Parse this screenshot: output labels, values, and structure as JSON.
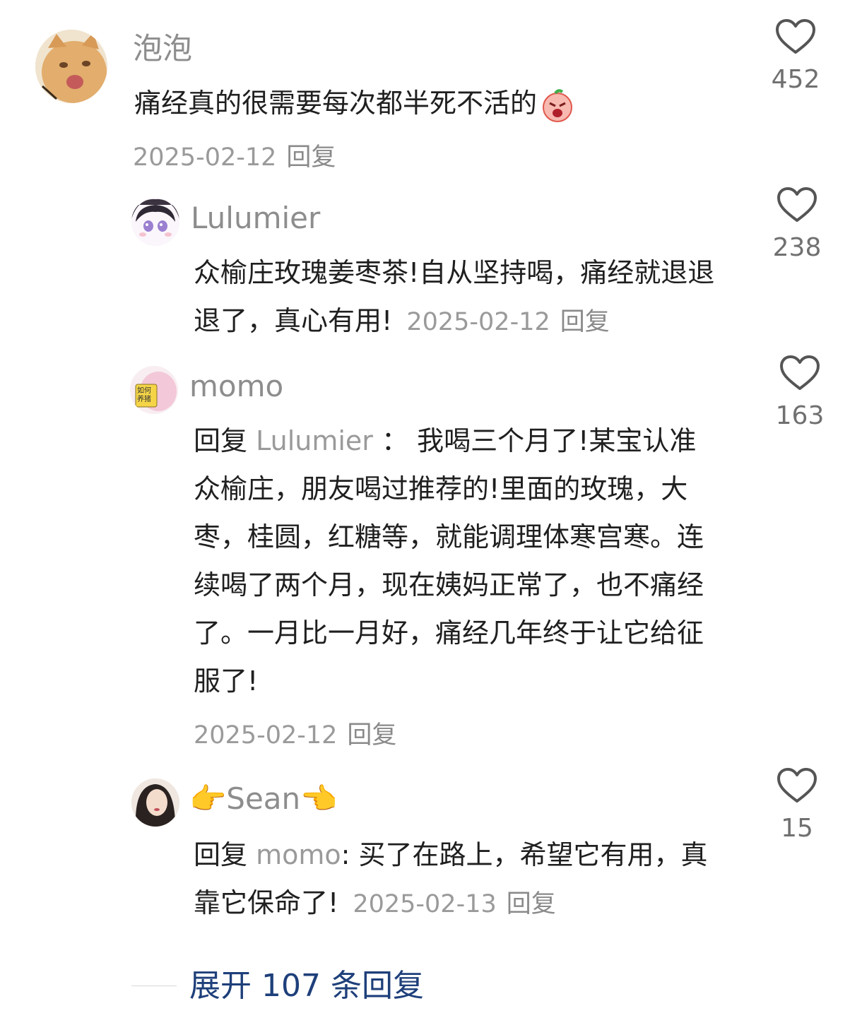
{
  "comments": [
    {
      "username": "泡泡",
      "text": "痛经真的很需要每次都半死不活的",
      "emoji": "angry-emoji-icon",
      "date": "2025-02-12",
      "reply_label": "回复",
      "likes": "452"
    }
  ],
  "replies": [
    {
      "username": "Lulumier",
      "text": "众榆庄玫瑰姜枣茶!自从坚持喝，痛经就退退退了，真心有用!",
      "date": "2025-02-12",
      "reply_label": "回复",
      "likes": "238"
    },
    {
      "username": "momo",
      "reply_prefix": "回复",
      "reply_to": "Lulumier",
      "separator": "：",
      "text": "我喝三个月了!某宝认准众榆庄，朋友喝过推荐的!里面的玫瑰，大枣，桂圆，红糖等，就能调理体寒宫寒。连续喝了两个月，现在姨妈正常了，也不痛经了。一月比一月好，痛经几年终于让它给征服了!",
      "date": "2025-02-12",
      "reply_label": "回复",
      "likes": "163",
      "avatar_text": "如何养猪"
    },
    {
      "username_prefix": "👉",
      "username": "Sean",
      "username_suffix": "👈",
      "reply_prefix": "回复",
      "reply_to": "momo",
      "separator": ":",
      "text": "买了在路上，希望它有用，真靠它保命了!",
      "date": "2025-02-13",
      "reply_label": "回复",
      "likes": "15"
    }
  ],
  "expand": {
    "label": "展开 107 条回复"
  },
  "colors": {
    "username": "#8d8d8d",
    "text": "#1f1f1f",
    "meta": "#9a9a9a",
    "expand": "#1e3f7a",
    "heart": "#555555"
  }
}
